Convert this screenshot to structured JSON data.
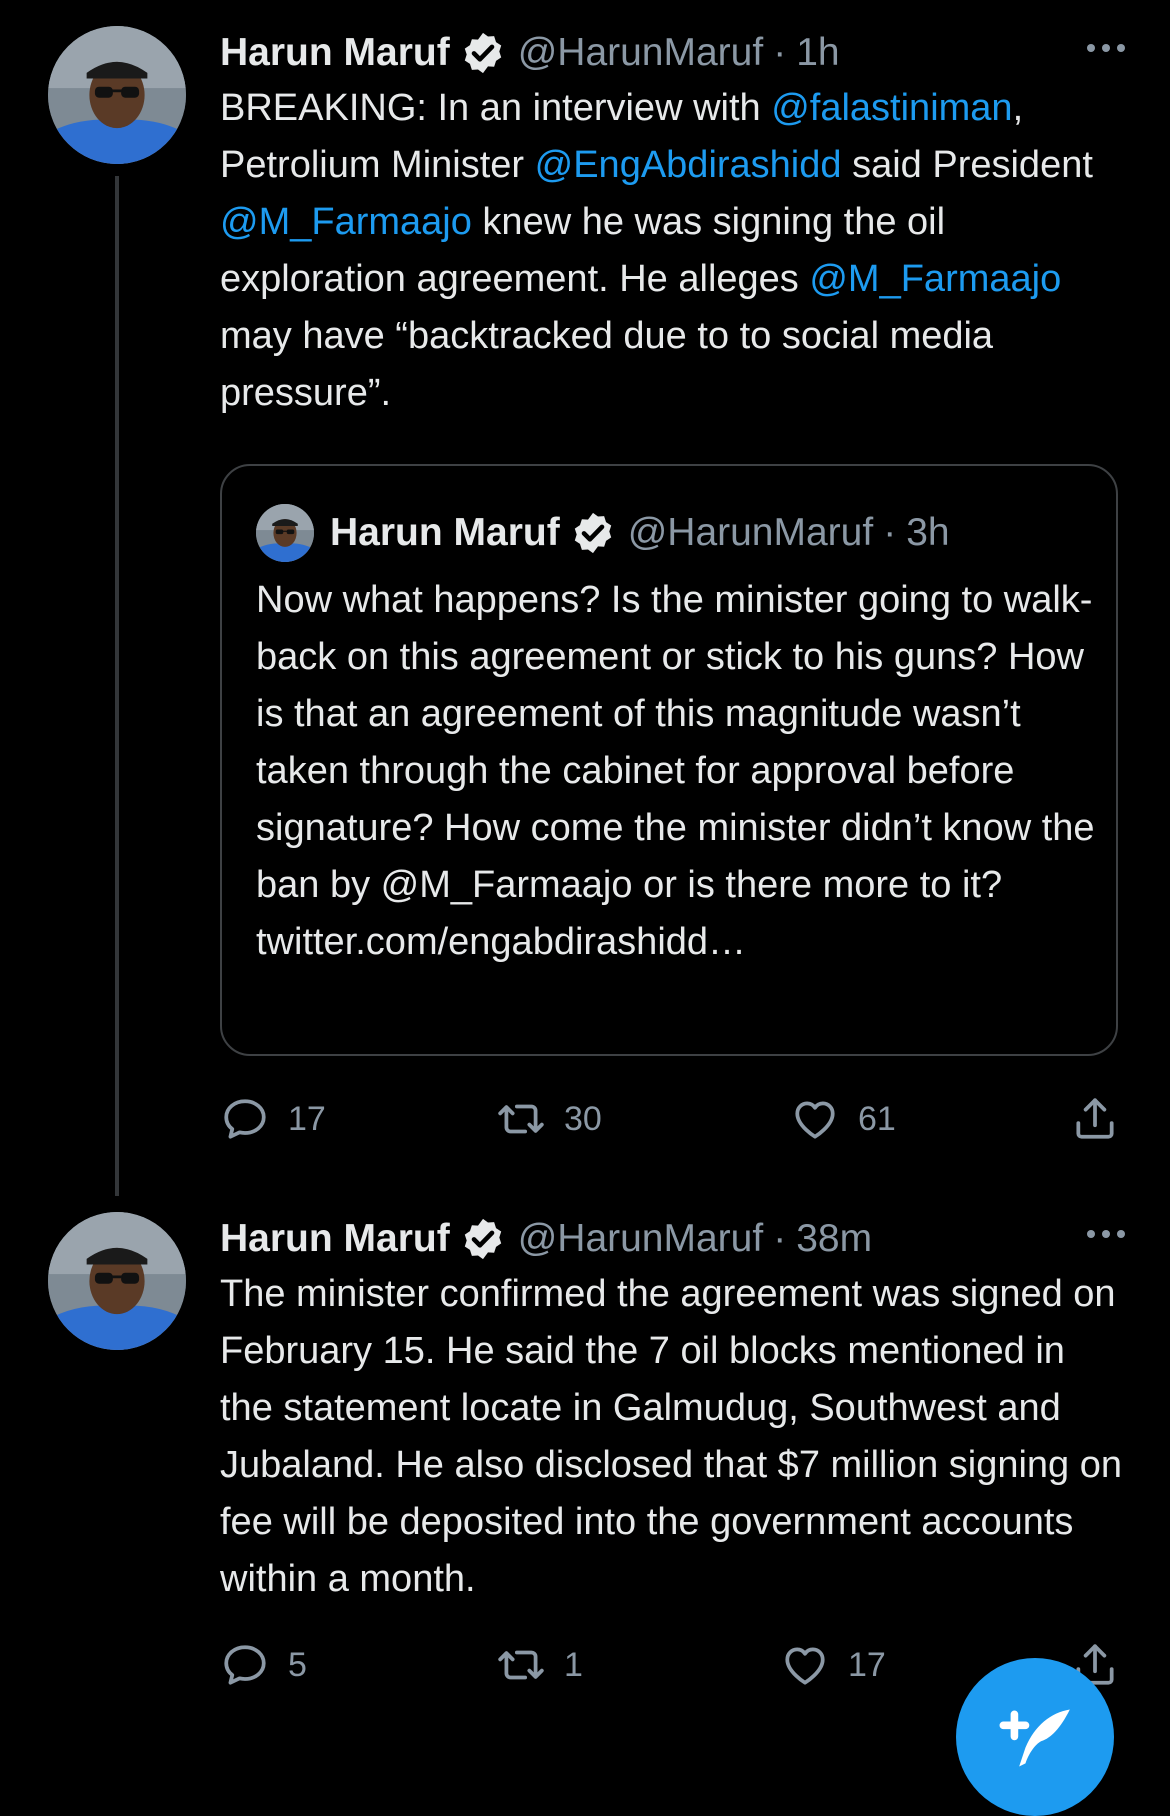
{
  "tweets": [
    {
      "author": "Harun Maruf",
      "handle": "@HarunMaruf",
      "dot": "·",
      "time": "1h",
      "text_parts": [
        {
          "t": "BREAKING: In an interview with ",
          "m": false
        },
        {
          "t": "@falastiniman",
          "m": true
        },
        {
          "t": ", Petrolium Minister ",
          "m": false
        },
        {
          "t": "@EngAbdirashidd",
          "m": true
        },
        {
          "t": " said President ",
          "m": false
        },
        {
          "t": "@M_Farmaajo",
          "m": true
        },
        {
          "t": " knew he was signing the oil exploration agreement. He alleges ",
          "m": false
        },
        {
          "t": "@M_Farmaajo",
          "m": true
        },
        {
          "t": " may have “backtracked due to to social media pressure”.",
          "m": false
        }
      ],
      "quote": {
        "author": "Harun Maruf",
        "handle": "@HarunMaruf",
        "dot": "·",
        "time": "3h",
        "text": "Now what happens? Is the minister going to walk-back on this agreement or stick to his guns? How is that an agreement of this magnitude wasn’t taken through the cabinet for approval before signature? How come the minister didn’t know the ban by @M_Farmaajo or is there more to it? twitter.com/engabdirashidd…"
      },
      "replies": "17",
      "retweets": "30",
      "likes": "61"
    },
    {
      "author": "Harun Maruf",
      "handle": "@HarunMaruf",
      "dot": "·",
      "time": "38m",
      "text": "The minister confirmed the agreement was signed on February 15. He said the 7 oil blocks mentioned in the statement locate in Galmudug, Southwest and Jubaland. He also disclosed that $7 million signing on fee will be deposited into the government accounts within a month.",
      "replies": "5",
      "retweets": "1",
      "likes": "17"
    }
  ],
  "colors": {
    "background": "#000000",
    "text": "#e7e9ea",
    "secondary": "#8b98a5",
    "accent": "#1d9bf0",
    "border": "#3e4144"
  },
  "icons": [
    "verified-badge-icon",
    "more-icon",
    "reply-icon",
    "retweet-icon",
    "like-icon",
    "share-icon",
    "compose-tweet-icon"
  ]
}
